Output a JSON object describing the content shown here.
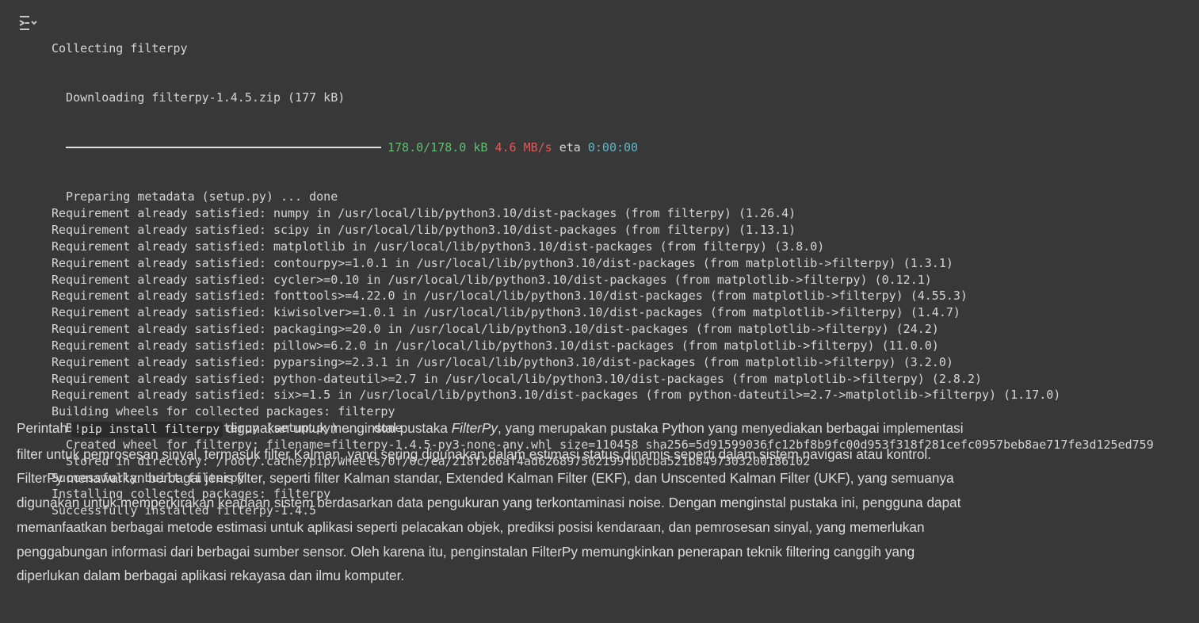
{
  "output": {
    "toggle_icon": "output-collapse-icon",
    "lines": [
      "Collecting filterpy"
    ],
    "download_line": "  Downloading filterpy-1.4.5.zip (177 kB)",
    "progress": {
      "size": "178.0/178.0 kB",
      "speed": "4.6 MB/s",
      "eta_label": "eta",
      "eta": "0:00:00",
      "fraction": 1.0
    },
    "after_progress": [
      "  Preparing metadata (setup.py) ... done",
      "Requirement already satisfied: numpy in /usr/local/lib/python3.10/dist-packages (from filterpy) (1.26.4)",
      "Requirement already satisfied: scipy in /usr/local/lib/python3.10/dist-packages (from filterpy) (1.13.1)",
      "Requirement already satisfied: matplotlib in /usr/local/lib/python3.10/dist-packages (from filterpy) (3.8.0)",
      "Requirement already satisfied: contourpy>=1.0.1 in /usr/local/lib/python3.10/dist-packages (from matplotlib->filterpy) (1.3.1)",
      "Requirement already satisfied: cycler>=0.10 in /usr/local/lib/python3.10/dist-packages (from matplotlib->filterpy) (0.12.1)",
      "Requirement already satisfied: fonttools>=4.22.0 in /usr/local/lib/python3.10/dist-packages (from matplotlib->filterpy) (4.55.3)",
      "Requirement already satisfied: kiwisolver>=1.0.1 in /usr/local/lib/python3.10/dist-packages (from matplotlib->filterpy) (1.4.7)",
      "Requirement already satisfied: packaging>=20.0 in /usr/local/lib/python3.10/dist-packages (from matplotlib->filterpy) (24.2)",
      "Requirement already satisfied: pillow>=6.2.0 in /usr/local/lib/python3.10/dist-packages (from matplotlib->filterpy) (11.0.0)",
      "Requirement already satisfied: pyparsing>=2.3.1 in /usr/local/lib/python3.10/dist-packages (from matplotlib->filterpy) (3.2.0)",
      "Requirement already satisfied: python-dateutil>=2.7 in /usr/local/lib/python3.10/dist-packages (from matplotlib->filterpy) (2.8.2)",
      "Requirement already satisfied: six>=1.5 in /usr/local/lib/python3.10/dist-packages (from python-dateutil>=2.7->matplotlib->filterpy) (1.17.0)",
      "Building wheels for collected packages: filterpy",
      "  Building wheel for filterpy (setup.py) ... done",
      "  Created wheel for filterpy: filename=filterpy-1.4.5-py3-none-any.whl size=110458 sha256=5d91599036fc12bf8b9fc00d953f318f281cefc0957beb8ae717fe3d125ed759",
      "  Stored in directory: /root/.cache/pip/wheels/0f/0c/ea/218f266af4ad626897562199fbbcba521b8497303200186102",
      "Successfully built filterpy",
      "Installing collected packages: filterpy",
      "Successfully installed filterpy-1.4.5"
    ]
  },
  "text_cell": {
    "intro": "Perintah ",
    "code": "!pip install filterpy",
    "after_code": " digunakan untuk menginstal pustaka ",
    "emphasis": "FilterPy",
    "body": ", yang merupakan pustaka Python yang menyediakan berbagai implementasi filter untuk pemrosesan sinyal, termasuk filter Kalman, yang sering digunakan dalam estimasi status dinamis seperti dalam sistem navigasi atau kontrol. FilterPy menawarkan berbagai jenis filter, seperti filter Kalman standar, Extended Kalman Filter (EKF), dan Unscented Kalman Filter (UKF), yang semuanya digunakan untuk memperkirakan keadaan sistem berdasarkan data pengukuran yang terkontaminasi noise. Dengan menginstal pustaka ini, pengguna dapat memanfaatkan berbagai metode estimasi untuk aplikasi seperti pelacakan objek, prediksi posisi kendaraan, dan pemrosesan sinyal, yang memerlukan penggabungan informasi dari berbagai sumber sensor. Oleh karena itu, penginstalan FilterPy memungkinkan penerapan teknik filtering canggih yang diperlukan dalam berbagai aplikasi rekayasa dan ilmu komputer."
  },
  "colors": {
    "background": "#383838",
    "output_text": "#d5d5d5",
    "progress_size": "#5fbf72",
    "progress_speed": "#e05a5a",
    "progress_eta": "#5fb7c6"
  }
}
